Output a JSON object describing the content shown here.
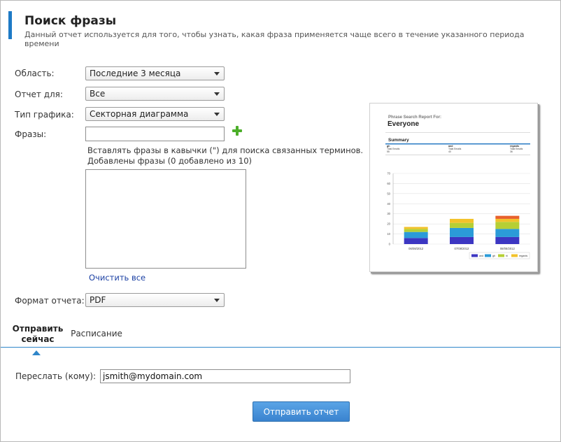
{
  "header": {
    "title": "Поиск фразы",
    "subtitle": "Данный отчет используется для того, чтобы узнать, какая фраза применяется чаще всего в течение указанного периода времени"
  },
  "form": {
    "scope_label": "Область:",
    "scope_value": "Последние 3 месяца",
    "report_for_label": "Отчет для:",
    "report_for_value": "Все",
    "chart_type_label": "Тип графика:",
    "chart_type_value": "Секторная диаграмма",
    "phrases_label": "Фразы:",
    "phrase_input_value": "",
    "hint_quotes": "Вставлять фразы в кавычки (\") для поиска связанных терминов.",
    "phrases_added": "Добавлены фразы (0 добавлено из 10)",
    "clear_all": "Очистить все",
    "format_label": "Формат отчета:",
    "format_value": "PDF"
  },
  "icons": {
    "add": "plus-icon",
    "dropdown": "chevron-down-icon",
    "active_tab_pointer": "triangle-up-icon"
  },
  "tabs": [
    {
      "line1": "Отправить",
      "line2": "сейчас",
      "active": true
    },
    {
      "line1": "Расписание",
      "active": false
    }
  ],
  "send": {
    "forward_label": "Переслать (кому):",
    "forward_value": "jsmith@mydomain.com",
    "send_button": "Отправить отчет"
  },
  "preview": {
    "report_title": "Phrase Search Report For:",
    "report_subject": "Everyone",
    "summary_heading": "Summary",
    "summary": [
      {
        "name": "gh",
        "label": "Total Emails",
        "value": "55"
      },
      {
        "name": "and",
        "label": "Total Emails",
        "value": "40"
      },
      {
        "name": "regards",
        "label": "Total Emails",
        "value": "36"
      }
    ],
    "chart_data": {
      "type": "bar",
      "stacked": true,
      "categories": [
        "06/08/2012",
        "07/08/2012",
        "08/08/2012"
      ],
      "ylim": [
        0,
        70
      ],
      "yticks": [
        "0",
        "10",
        "20",
        "30",
        "40",
        "50",
        "60",
        "70"
      ],
      "series": [
        {
          "name": "and",
          "color": "#3c36c2",
          "values": [
            6,
            7,
            7
          ]
        },
        {
          "name": "gh",
          "color": "#2b9bd8",
          "values": [
            6,
            9,
            8
          ]
        },
        {
          "name": "hi",
          "color": "#b6cf35",
          "values": [
            3,
            5,
            7
          ]
        },
        {
          "name": "regards",
          "color": "#f2c22a",
          "values": [
            2,
            4,
            3
          ]
        }
      ],
      "extra_top": {
        "color": "#e8602c",
        "values": [
          0,
          0,
          3
        ]
      }
    }
  }
}
